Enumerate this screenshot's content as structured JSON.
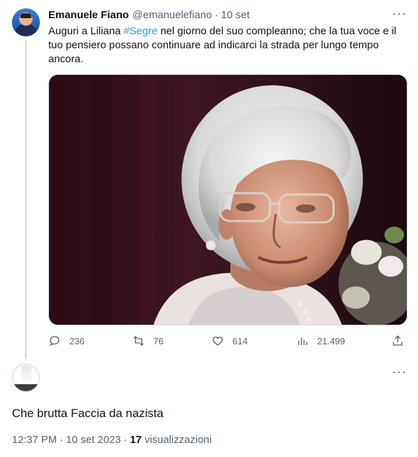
{
  "tweet": {
    "author_name": "Emanuele Fiano",
    "author_handle": "@emanuelefiano",
    "separator": "·",
    "date": "10 set",
    "text_before": "Auguri a Liliana ",
    "hashtag": "#Segre",
    "text_after": " nel giorno del suo compleanno; che la tua voce e il tuo pensiero possano continuare ad indicarci la strada per lungo tempo ancora.",
    "more_icon": "···",
    "media_description_icon": "photo",
    "actions": {
      "replies": "236",
      "retweets": "76",
      "likes": "614",
      "views": "21.499"
    }
  },
  "reply": {
    "more_icon": "···",
    "text": "Che brutta Faccia da nazista",
    "time": "12:37 PM",
    "separator1": "·",
    "date": "10 set 2023",
    "separator2": "·",
    "views_count": "17",
    "views_label": "visualizzazioni"
  },
  "colors": {
    "accent": "#1d9bf0",
    "secondary_text": "#536471",
    "primary_text": "#0f1419",
    "border": "#cfd9de"
  }
}
